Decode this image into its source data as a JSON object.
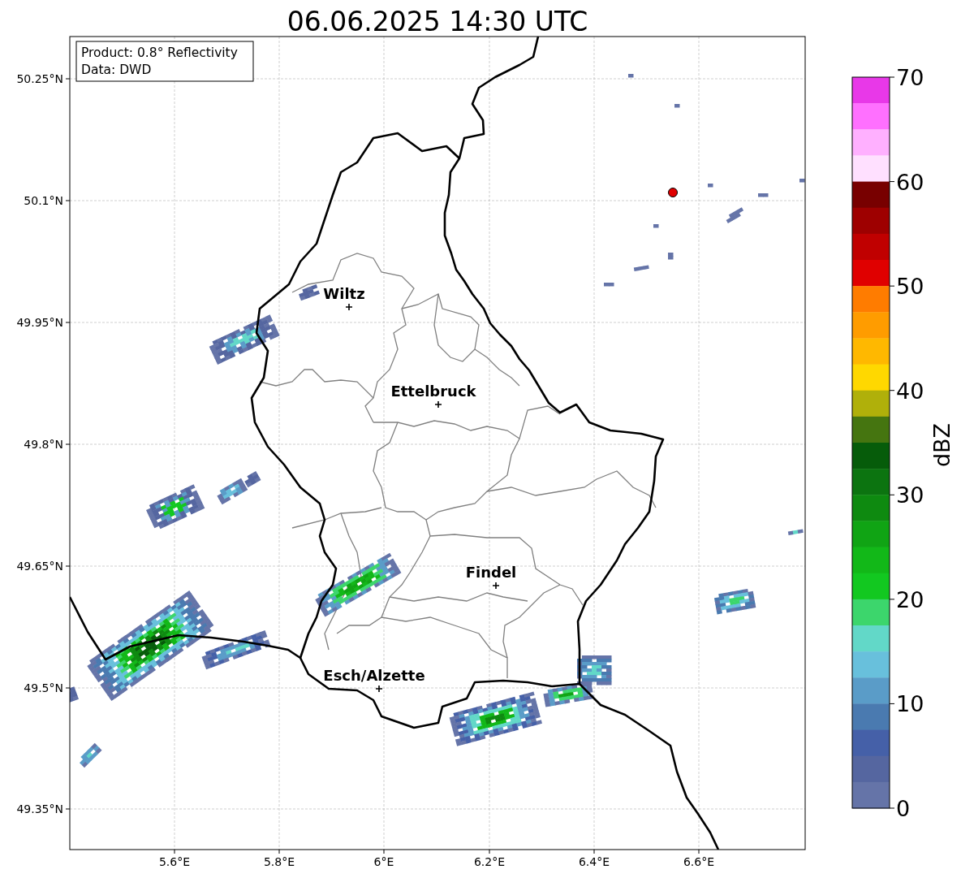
{
  "title": "06.06.2025 14:30 UTC",
  "info_box": {
    "lines": [
      "Product: 0.8° Reflectivity",
      "Data: DWD"
    ]
  },
  "map": {
    "x_ticks": [
      "5.6°E",
      "5.8°E",
      "6°E",
      "6.2°E",
      "6.4°E",
      "6.6°E"
    ],
    "y_ticks": [
      "50.25°N",
      "50.1°N",
      "49.95°N",
      "49.8°N",
      "49.65°N",
      "49.5°N",
      "49.35°N"
    ],
    "cities": [
      {
        "name": "Wiltz"
      },
      {
        "name": "Ettelbruck"
      },
      {
        "name": "Findel"
      },
      {
        "name": "Esch/Alzette"
      }
    ]
  },
  "colorbar": {
    "label": "dBZ",
    "ticks": [
      "70",
      "60",
      "50",
      "40",
      "30",
      "20",
      "10",
      "0"
    ],
    "segments": [
      {
        "color": "#e838e8"
      },
      {
        "color": "#ff70ff"
      },
      {
        "color": "#ffb0ff"
      },
      {
        "color": "#ffe0ff"
      },
      {
        "color": "#780000"
      },
      {
        "color": "#9e0000"
      },
      {
        "color": "#c00000"
      },
      {
        "color": "#e00000"
      },
      {
        "color": "#ff7c00"
      },
      {
        "color": "#ff9c00"
      },
      {
        "color": "#ffb800"
      },
      {
        "color": "#ffd800"
      },
      {
        "color": "#b0b00a"
      },
      {
        "color": "#457510"
      },
      {
        "color": "#065c0a"
      },
      {
        "color": "#0c7410"
      },
      {
        "color": "#0e8a10"
      },
      {
        "color": "#10a414"
      },
      {
        "color": "#12b818"
      },
      {
        "color": "#12c820"
      },
      {
        "color": "#3cd66c"
      },
      {
        "color": "#62d8c8"
      },
      {
        "color": "#68c0dc"
      },
      {
        "color": "#5a9cc8"
      },
      {
        "color": "#4a7ab0"
      },
      {
        "color": "#4560a8"
      },
      {
        "color": "#5566a0"
      },
      {
        "color": "#6574a8"
      }
    ]
  }
}
